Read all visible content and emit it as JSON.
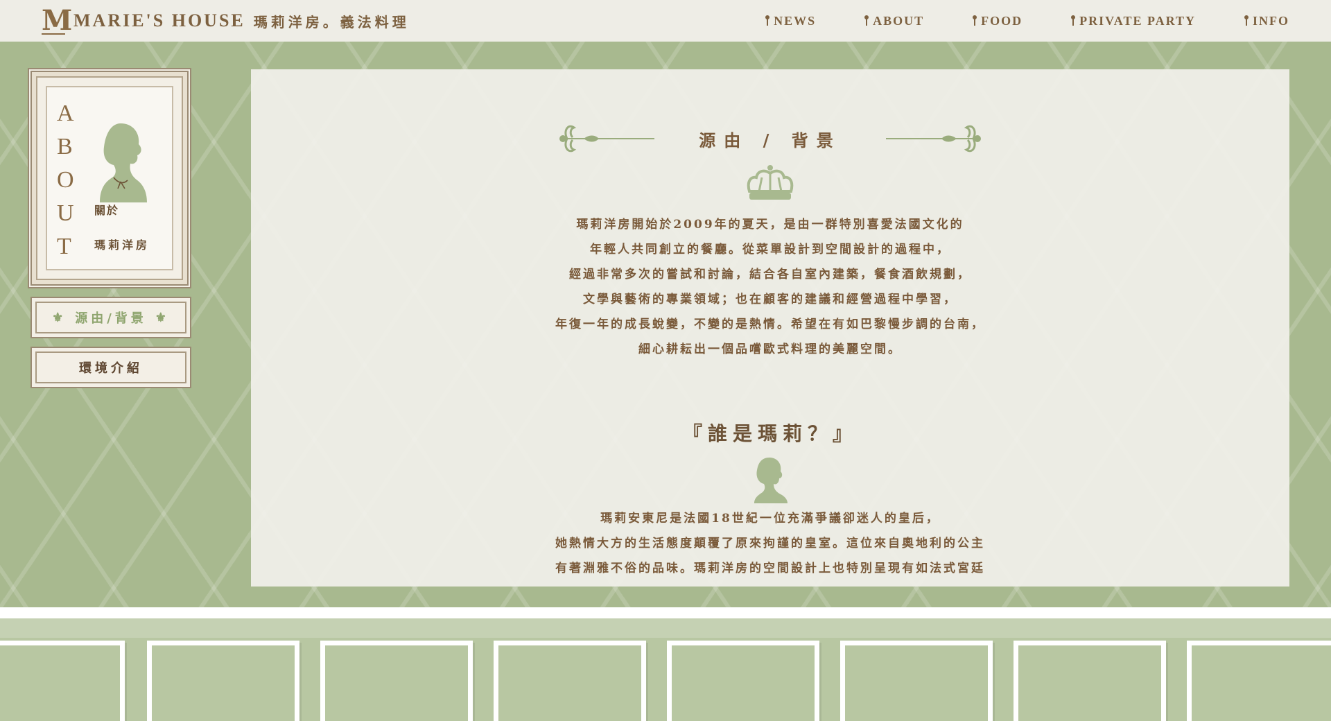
{
  "header": {
    "logo_letter": "M",
    "brand_name": "MARIE'S HOUSE",
    "brand_sub": "瑪莉洋房。義法料理",
    "nav": [
      {
        "label": "NEWS",
        "icon": "keyhole-icon"
      },
      {
        "label": "ABOUT",
        "icon": "keyhole-icon"
      },
      {
        "label": "FOOD",
        "icon": "keyhole-icon"
      },
      {
        "label": "PRIVATE PARTY",
        "icon": "keyhole-icon"
      },
      {
        "label": "INFO",
        "icon": "keyhole-icon"
      }
    ]
  },
  "sidebar": {
    "about_letters": [
      "A",
      "B",
      "O",
      "U",
      "T"
    ],
    "about_zh": "關於",
    "about_zh2": "瑪莉洋房",
    "buttons": [
      {
        "label": "源由/背景",
        "active": true
      },
      {
        "label": "環境介紹",
        "active": false
      }
    ]
  },
  "content": {
    "section_title": "源由 / 背景",
    "intro_lines": [
      "瑪莉洋房開始於2009年的夏天，是由一群特別喜愛法國文化的",
      "年輕人共同創立的餐廳。從菜單設計到空間設計的過程中，",
      "經過非常多次的嘗試和討論，結合各自室內建築，餐食酒飲規劃，",
      "文學與藝術的專業領域；也在顧客的建議和經營過程中學習，",
      "年復一年的成長蛻變，不變的是熱情。希望在有如巴黎慢步調的台南，",
      "細心耕耘出一個品嚐歐式料理的美麗空間。"
    ],
    "who_title": "『誰是瑪莉？』",
    "marie_lines": [
      "瑪莉安東尼是法國18世紀一位充滿爭議卻迷人的皇后，",
      "她熱情大方的生活態度顛覆了原來拘謹的皇室。這位來自奧地利的公主",
      "有著淵雅不俗的品味。瑪莉洋房的空間設計上也特別呈現有如法式宮廷"
    ]
  },
  "colors": {
    "topbar_bg": "#eeede6",
    "wall_green": "#a8b98f",
    "text_brown": "#7a5a3a",
    "accent_green": "#8fa56f"
  }
}
